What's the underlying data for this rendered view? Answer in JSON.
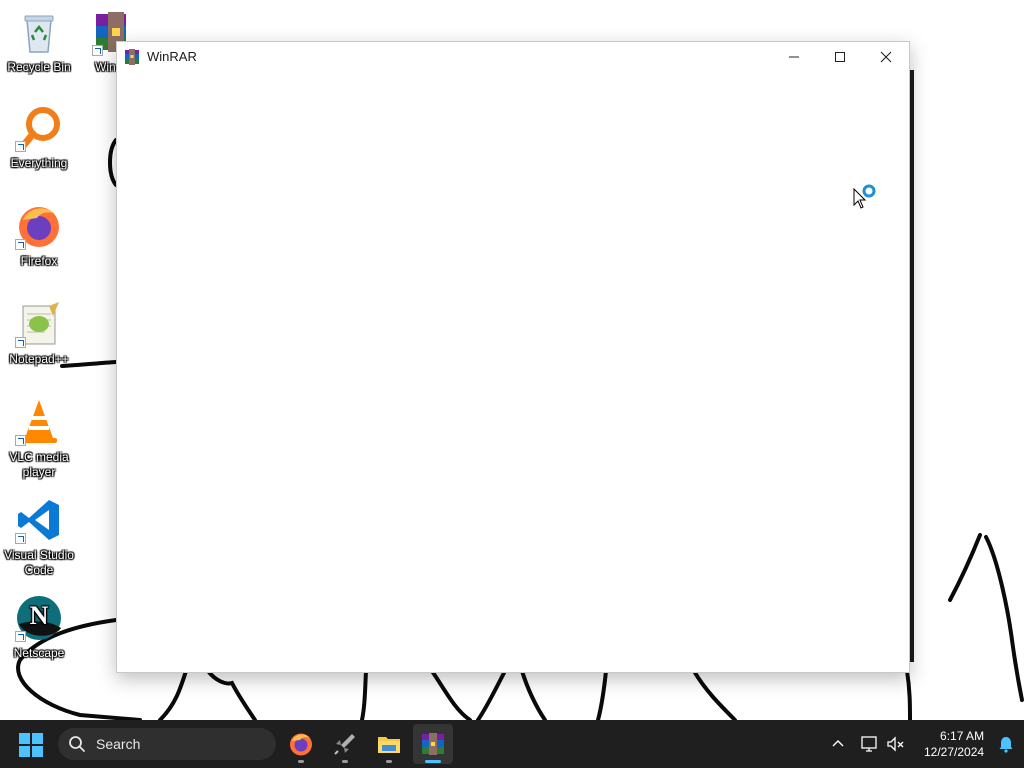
{
  "desktop": {
    "icons": [
      {
        "label": "Recycle Bin",
        "icon": "recycle-bin-icon"
      },
      {
        "label": "Win",
        "icon": "winrar-icon"
      },
      {
        "label": "Everything",
        "icon": "everything-icon"
      },
      {
        "label": "Firefox",
        "icon": "firefox-icon"
      },
      {
        "label": "Notepad++",
        "icon": "notepad-plus-plus-icon"
      },
      {
        "label": "VLC media player",
        "icon": "vlc-icon"
      },
      {
        "label": "Visual Studio Code",
        "icon": "vscode-icon"
      },
      {
        "label": "Netscape",
        "icon": "netscape-icon"
      }
    ]
  },
  "window": {
    "title": "WinRAR",
    "buttons": {
      "minimize": "minimize-icon",
      "maximize": "maximize-icon",
      "close": "close-icon"
    }
  },
  "taskbar": {
    "search_placeholder": "Search",
    "apps": [
      {
        "name": "Firefox",
        "icon": "firefox-icon"
      },
      {
        "name": "Unknown app",
        "icon": "rocket-icon"
      },
      {
        "name": "File Explorer",
        "icon": "folder-icon"
      },
      {
        "name": "WinRAR",
        "icon": "winrar-icon",
        "active": true
      }
    ],
    "clock": {
      "time": "6:17 AM",
      "date": "12/27/2024"
    }
  },
  "colors": {
    "taskbar_bg": "#1f1f1f",
    "active_indicator": "#4cc2ff",
    "window_bg": "#ffffff"
  }
}
